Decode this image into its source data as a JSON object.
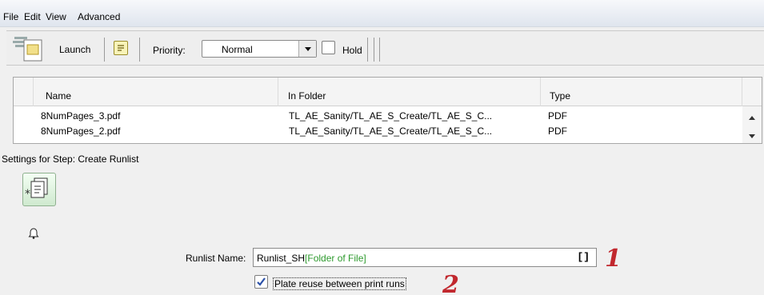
{
  "menubar": {
    "items": [
      "File",
      "Edit",
      "View",
      "Advanced"
    ]
  },
  "toolbar": {
    "launch_label": "Launch",
    "priority_label": "Priority:",
    "priority_value": "Normal",
    "hold_label": "Hold"
  },
  "table": {
    "columns": [
      "Name",
      "In Folder",
      "Type"
    ],
    "rows": [
      {
        "name": "8NumPages_3.pdf",
        "folder": "TL_AE_Sanity/TL_AE_S_Create/TL_AE_S_C...",
        "type": "PDF"
      },
      {
        "name": "8NumPages_2.pdf",
        "folder": "TL_AE_Sanity/TL_AE_S_Create/TL_AE_S_C...",
        "type": "PDF"
      }
    ]
  },
  "settings": {
    "header": "Settings for Step: Create Runlist",
    "runlist_label": "Runlist Name:",
    "runlist_prefix": "Runlist_SH",
    "runlist_token": "[Folder of File]",
    "bracket_button": "[]",
    "plate_reuse_label": "Plate reuse between print runs",
    "plate_reuse_checked": true
  },
  "annotations": {
    "marker1": "1",
    "marker2": "2"
  },
  "colors": {
    "token_green": "#2d9a2d",
    "marker_red": "#c1282e",
    "menubar_top": "#f7f8fb"
  }
}
